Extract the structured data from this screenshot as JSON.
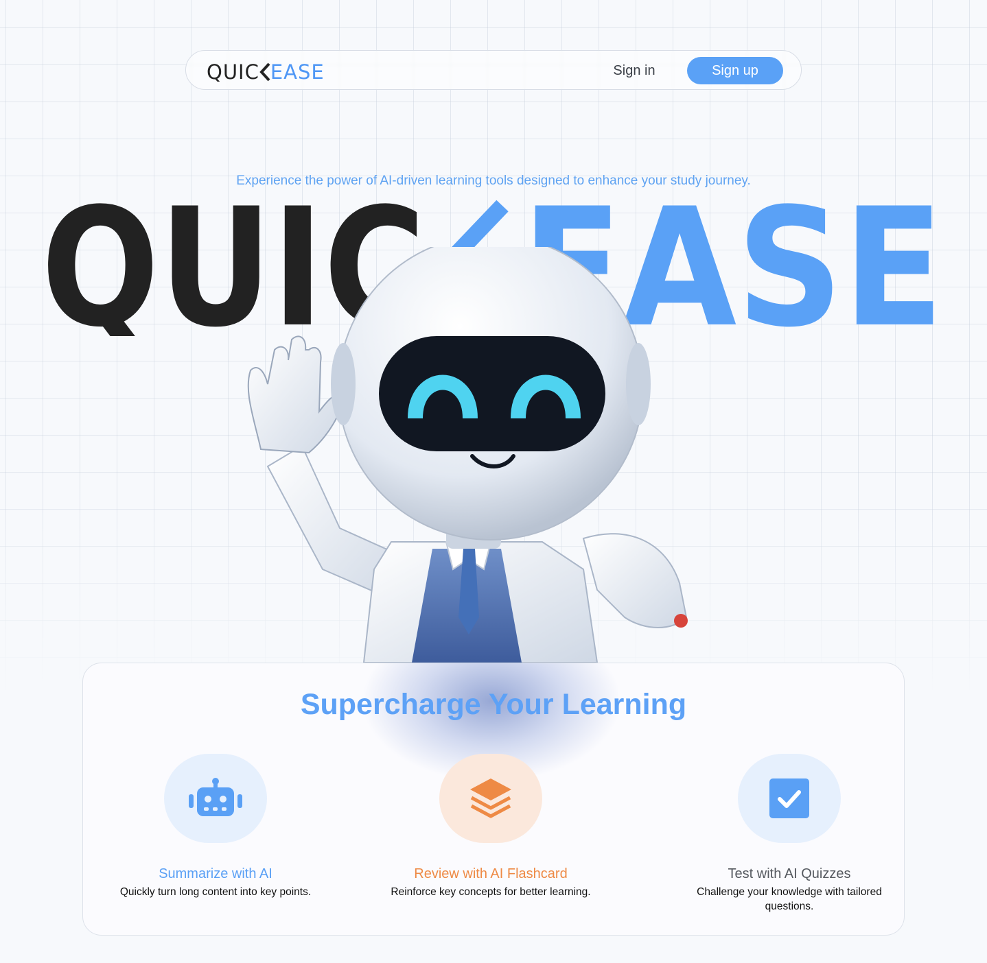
{
  "nav": {
    "logo": {
      "part1": "QUIC",
      "part2": "EASE"
    },
    "signin_label": "Sign in",
    "signup_label": "Sign up"
  },
  "hero": {
    "tagline": "Experience the power of AI-driven learning tools designed to enhance your study journey.",
    "wordmark_part1": "QUIC",
    "wordmark_part2": "EASE"
  },
  "features_section": {
    "title": "Supercharge Your Learning",
    "features": [
      {
        "title": "Summarize with AI",
        "description": "Quickly turn long content into key points.",
        "icon": "robot-icon",
        "color": "#5aa0f5",
        "bg": "#e6f0fd"
      },
      {
        "title": "Review with AI Flashcard",
        "description": "Reinforce key concepts for better learning.",
        "icon": "layers-icon",
        "color": "#ee8a45",
        "bg": "#fbe8dc"
      },
      {
        "title": "Test with AI Quizzes",
        "description": "Challenge your knowledge with tailored questions.",
        "icon": "checkbox-icon",
        "color": "#55595f",
        "bg": "#e6f0fd"
      }
    ]
  },
  "colors": {
    "brand_blue": "#5aa1f6",
    "dark": "#222222",
    "orange": "#ee8a45"
  }
}
